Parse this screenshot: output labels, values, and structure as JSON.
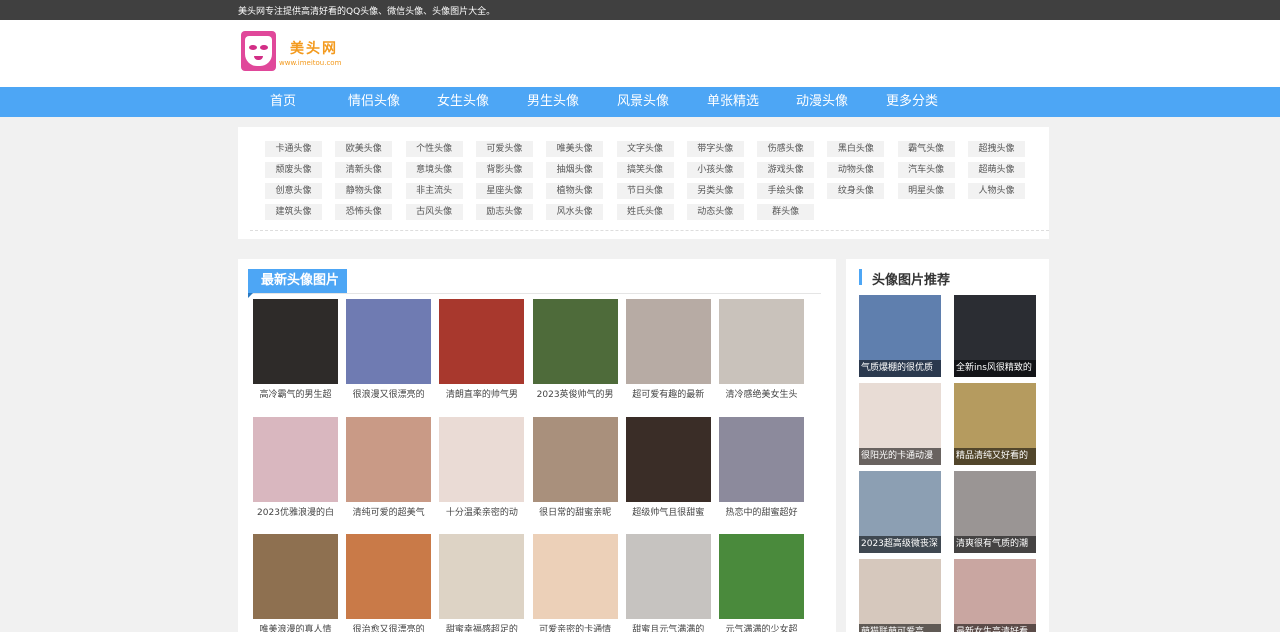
{
  "topbar": {
    "notice": "美头网专注提供高清好看的QQ头像、微信头像、头像图片大全。"
  },
  "logo": {
    "title": "美头网",
    "url": "www.imeitou.com"
  },
  "nav": [
    "首页",
    "情侣头像",
    "女生头像",
    "男生头像",
    "风景头像",
    "单张精选",
    "动漫头像",
    "更多分类"
  ],
  "tags": [
    [
      "卡通头像",
      "欧美头像",
      "个性头像",
      "可爱头像",
      "唯美头像",
      "文字头像",
      "带字头像",
      "伤感头像",
      "黑白头像",
      "霸气头像",
      "超拽头像"
    ],
    [
      "颓废头像",
      "清新头像",
      "意境头像",
      "背影头像",
      "抽烟头像",
      "搞笑头像",
      "小孩头像",
      "游戏头像",
      "动物头像",
      "汽车头像",
      "超萌头像"
    ],
    [
      "创意头像",
      "静物头像",
      "非主流头",
      "星座头像",
      "植物头像",
      "节日头像",
      "另类头像",
      "手绘头像",
      "纹身头像",
      "明星头像",
      "人物头像"
    ],
    [
      "建筑头像",
      "恐怖头像",
      "古风头像",
      "励志头像",
      "风水头像",
      "姓氏头像",
      "动态头像",
      "群头像"
    ]
  ],
  "main": {
    "title": "最新头像图片",
    "cards": [
      [
        "高冷霸气的男生超",
        "很浪漫又很漂亮的",
        "清朗直率的帅气男",
        "2023英俊帅气的男",
        "超可爱有趣的最新",
        "清冷感绝美女生头"
      ],
      [
        "2023优雅浪漫的白",
        "清纯可爱的超美气",
        "十分温柔亲密的动",
        "很日常的甜蜜亲昵",
        "超级帅气且很甜蜜",
        "热恋中的甜蜜超好"
      ],
      [
        "唯美浪漫的真人情",
        "很治愈又很漂亮的",
        "甜蜜幸福感超足的",
        "可爱亲密的卡通情",
        "甜蜜且元气满满的",
        "元气满满的少女超"
      ]
    ],
    "photo_colors": [
      [
        "#2e2b29",
        "#6f7bb2",
        "#a8382d",
        "#4e6b3a",
        "#b7aba4",
        "#c9c2bb"
      ],
      [
        "#d9b7bf",
        "#c99a86",
        "#eadbd5",
        "#a9907c",
        "#3a2d27",
        "#8c8a9c"
      ],
      [
        "#8e7050",
        "#c97a48",
        "#ddd3c5",
        "#ecd0b8",
        "#c6c3c0",
        "#4a8a3c"
      ]
    ]
  },
  "side": {
    "title": "头像图片推荐",
    "cards": [
      "气质爆棚的很优质",
      "全新ins风很精致的",
      "很阳光的卡通动漫",
      "精品清纯又好看的",
      "2023超高级微丧深",
      "清爽很有气质的潮",
      "萌猫联萌可爱高",
      "最新女生高清好看"
    ],
    "photo_colors": [
      "#5f7fae",
      "#2b2d33",
      "#e8dcd5",
      "#b59b5f",
      "#8c9fb3",
      "#9a9594",
      "#d6c8bd",
      "#c9a6a1"
    ]
  },
  "colors": {
    "accent": "#4da6f5",
    "topbar": "#404040",
    "logo": "#f39a1e",
    "logo_mask": "#e0489a"
  }
}
